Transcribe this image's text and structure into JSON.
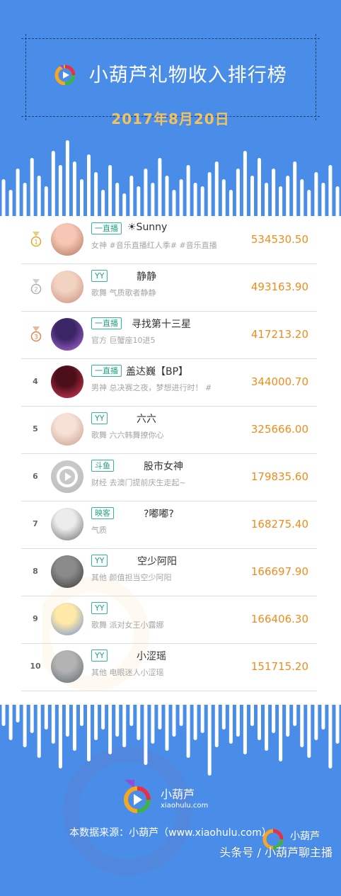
{
  "header": {
    "title": "小葫芦礼物收入排行榜",
    "date": "2017年8月20日"
  },
  "rows": [
    {
      "rank": "1",
      "platform": "一直播",
      "name": "☀Sunny",
      "tags": "女神 #音乐直播红人季# #音乐直播",
      "score": "534530.50"
    },
    {
      "rank": "2",
      "platform": "YY",
      "name": "静静",
      "tags": "歌舞 气质歌者静静",
      "score": "493163.90"
    },
    {
      "rank": "3",
      "platform": "一直播",
      "name": "寻找第十三星",
      "tags": "官方 巨蟹座10进5",
      "score": "417213.20"
    },
    {
      "rank": "4",
      "platform": "一直播",
      "name": "盖达巍【BP】",
      "tags": "男神 总决赛之夜，梦想进行时！ #",
      "score": "344000.70"
    },
    {
      "rank": "5",
      "platform": "YY",
      "name": "六六",
      "tags": "歌舞 六六韩舞撩你心",
      "score": "325666.00"
    },
    {
      "rank": "6",
      "platform": "斗鱼",
      "name": "股市女神",
      "tags": "财经 去澳门提前庆生走起~",
      "score": "179835.60"
    },
    {
      "rank": "7",
      "platform": "映客",
      "name": "?嘟嘟?",
      "tags": "气质",
      "score": "168275.40"
    },
    {
      "rank": "8",
      "platform": "YY",
      "name": "空少阿阳",
      "tags": "其他 颜值担当空少阿阳",
      "score": "166697.90"
    },
    {
      "rank": "9",
      "platform": "YY",
      "name": "",
      "tags": "歌舞 派对女王小露娜",
      "score": "166406.30"
    },
    {
      "rank": "10",
      "platform": "YY",
      "name": "小涩瑶",
      "tags": "其他 电眼迷人小涩瑶",
      "score": "151715.20"
    }
  ],
  "footer": {
    "brand": "小葫芦",
    "domain": "xiaohulu.com",
    "source": "本数据来源：小葫芦（www.xiaohulu.com）",
    "credit": "头条号 / 小葫芦聊主播",
    "credit_brand": "小葫芦"
  },
  "colors": {
    "background": "#4a8de8",
    "date": "#f3c25a",
    "score": "#f08c1c",
    "badge": "#21a382"
  }
}
